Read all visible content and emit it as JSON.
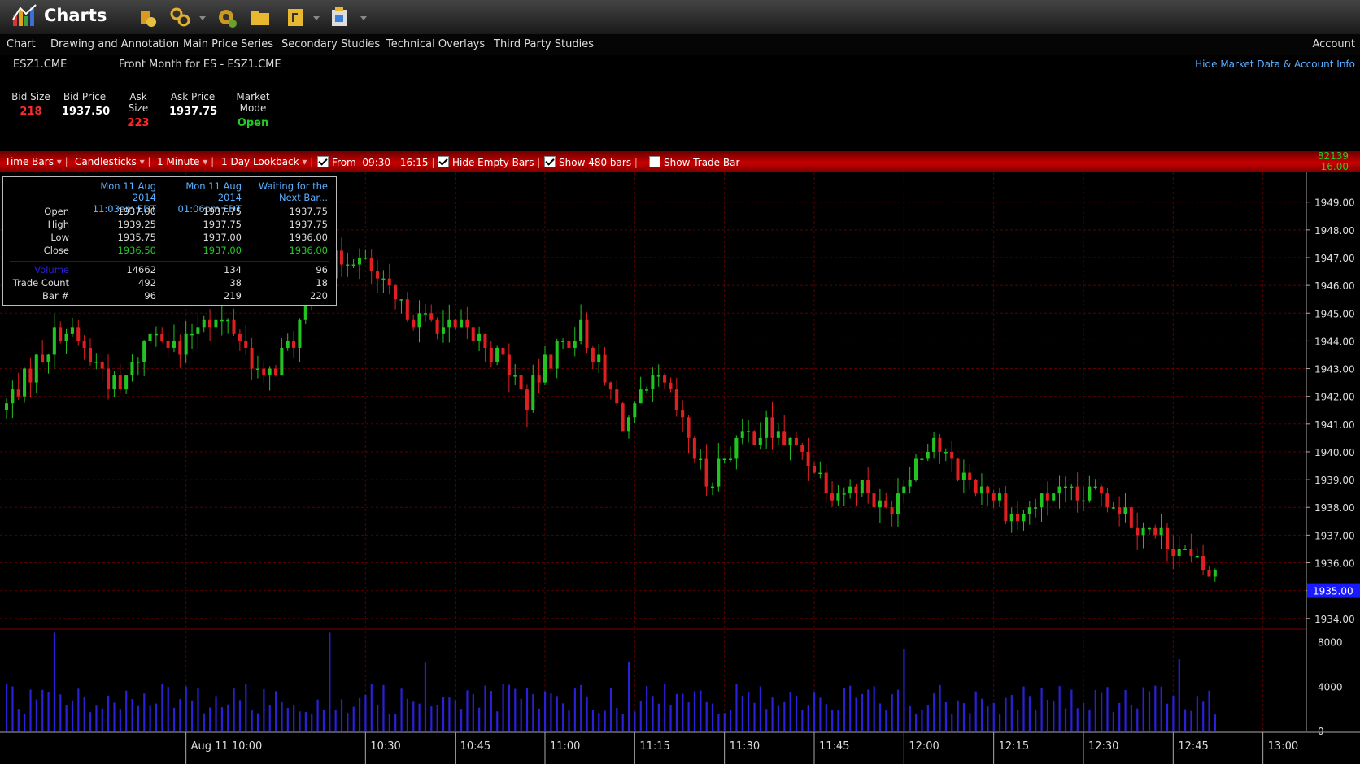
{
  "app": {
    "title": "Charts"
  },
  "menu": [
    "Chart",
    "Drawing and Annotation",
    "Main Price Series",
    "Secondary Studies",
    "Technical Overlays",
    "Third Party Studies"
  ],
  "account_label": "Account",
  "symbol": "ESZ1.CME",
  "symbol_desc": "Front Month for ES - ESZ1.CME",
  "hide_link": "Hide Market Data & Account Info",
  "quote": [
    {
      "label": "Bid Size",
      "value": "218",
      "color": "#ff2a2a"
    },
    {
      "label": "Bid Price",
      "value": "1937.50",
      "color": "#ffffff"
    },
    {
      "label": "Ask Size",
      "value": "223",
      "color": "#ff2a2a"
    },
    {
      "label": "Ask Price",
      "value": "1937.75",
      "color": "#ffffff"
    },
    {
      "label": "Market Mode",
      "value": "Open",
      "color": "#22cc22"
    }
  ],
  "chart_bar": {
    "time_bars": "Time Bars",
    "style": "Candlesticks",
    "interval": "1 Minute",
    "lookback": "1 Day Lookback",
    "from_label": "From",
    "from_range": "09:30 - 16:15",
    "hide_empty": "Hide Empty Bars",
    "show_bars": "Show 480 bars",
    "show_trade_bar": "Show Trade Bar",
    "last_volume": "82139",
    "net_change": "-16.00"
  },
  "tooltip": {
    "cols": [
      {
        "line1": "Mon 11 Aug 2014",
        "line2": "11:03am EDT",
        "open": "1937.00",
        "high": "1939.25",
        "low": "1935.75",
        "close": "1936.50",
        "volume": "14662",
        "trade_count": "492",
        "bar": "96"
      },
      {
        "line1": "Mon 11 Aug 2014",
        "line2": "01:06pm EDT",
        "open": "1937.75",
        "high": "1937.75",
        "low": "1937.00",
        "close": "1937.00",
        "volume": "134",
        "trade_count": "38",
        "bar": "219"
      },
      {
        "line1": "Waiting for the",
        "line2": "Next Bar...",
        "open": "1937.75",
        "high": "1937.75",
        "low": "1936.00",
        "close": "1936.00",
        "volume": "96",
        "trade_count": "18",
        "bar": "220"
      }
    ],
    "labels": {
      "open": "Open",
      "high": "High",
      "low": "Low",
      "close": "Close",
      "volume": "Volume",
      "trade_count": "Trade Count",
      "bar": "Bar #"
    }
  },
  "colors": {
    "up": "#22c422",
    "down": "#e02020",
    "volume": "#2a20d8",
    "grid": "#5a0000",
    "price_tag": "#1a1aff",
    "accent_blue": "#5ab0ff"
  },
  "chart_data": {
    "type": "candlestick",
    "y_ticks": [
      "1934.00",
      "1935.00",
      "1936.00",
      "1937.00",
      "1938.00",
      "1939.00",
      "1940.00",
      "1941.00",
      "1942.00",
      "1943.00",
      "1944.00",
      "1945.00",
      "1946.00",
      "1947.00",
      "1948.00",
      "1949.00"
    ],
    "ylim": [
      1933.7,
      1949.9
    ],
    "last_price_label": "1935.00",
    "x_labels": [
      "Aug 11 10:00",
      "10:30",
      "10:45",
      "11:00",
      "11:15",
      "11:30",
      "11:45",
      "12:00",
      "12:15",
      "12:30",
      "12:45",
      "13:00"
    ],
    "x_label_minutes": [
      30,
      60,
      75,
      90,
      105,
      120,
      135,
      150,
      165,
      180,
      195,
      210
    ],
    "x_range_minutes": [
      0,
      211
    ],
    "volume_ticks": [
      "0",
      "4000",
      "8000"
    ],
    "volume_max": 9000,
    "waypoints": [
      [
        0,
        1941.5
      ],
      [
        6,
        1943.2
      ],
      [
        10,
        1944.5
      ],
      [
        16,
        1943.2
      ],
      [
        20,
        1942.2
      ],
      [
        26,
        1944.6
      ],
      [
        30,
        1943.5
      ],
      [
        34,
        1945.0
      ],
      [
        40,
        1944.2
      ],
      [
        44,
        1942.5
      ],
      [
        50,
        1944.5
      ],
      [
        54,
        1946.3
      ],
      [
        58,
        1947.2
      ],
      [
        62,
        1946.5
      ],
      [
        66,
        1945.3
      ],
      [
        70,
        1944.8
      ],
      [
        75,
        1944.5
      ],
      [
        80,
        1944.0
      ],
      [
        84,
        1943.3
      ],
      [
        88,
        1941.8
      ],
      [
        92,
        1943.5
      ],
      [
        97,
        1944.5
      ],
      [
        100,
        1943.0
      ],
      [
        104,
        1941.0
      ],
      [
        110,
        1942.5
      ],
      [
        114,
        1941.0
      ],
      [
        118,
        1939.0
      ],
      [
        123,
        1940.3
      ],
      [
        128,
        1940.8
      ],
      [
        134,
        1940.0
      ],
      [
        140,
        1938.5
      ],
      [
        144,
        1938.8
      ],
      [
        148,
        1937.8
      ],
      [
        152,
        1939.5
      ],
      [
        156,
        1940.5
      ],
      [
        160,
        1939.2
      ],
      [
        166,
        1938.5
      ],
      [
        170,
        1937.6
      ],
      [
        176,
        1938.5
      ],
      [
        180,
        1938.2
      ],
      [
        184,
        1938.6
      ],
      [
        190,
        1937.5
      ],
      [
        196,
        1936.6
      ],
      [
        200,
        1935.8
      ],
      [
        202,
        1935.5
      ]
    ],
    "volume_spikes": [
      [
        8,
        8900
      ],
      [
        54,
        8900
      ],
      [
        70,
        6200
      ],
      [
        104,
        6300
      ],
      [
        150,
        7400
      ],
      [
        196,
        6500
      ]
    ]
  }
}
